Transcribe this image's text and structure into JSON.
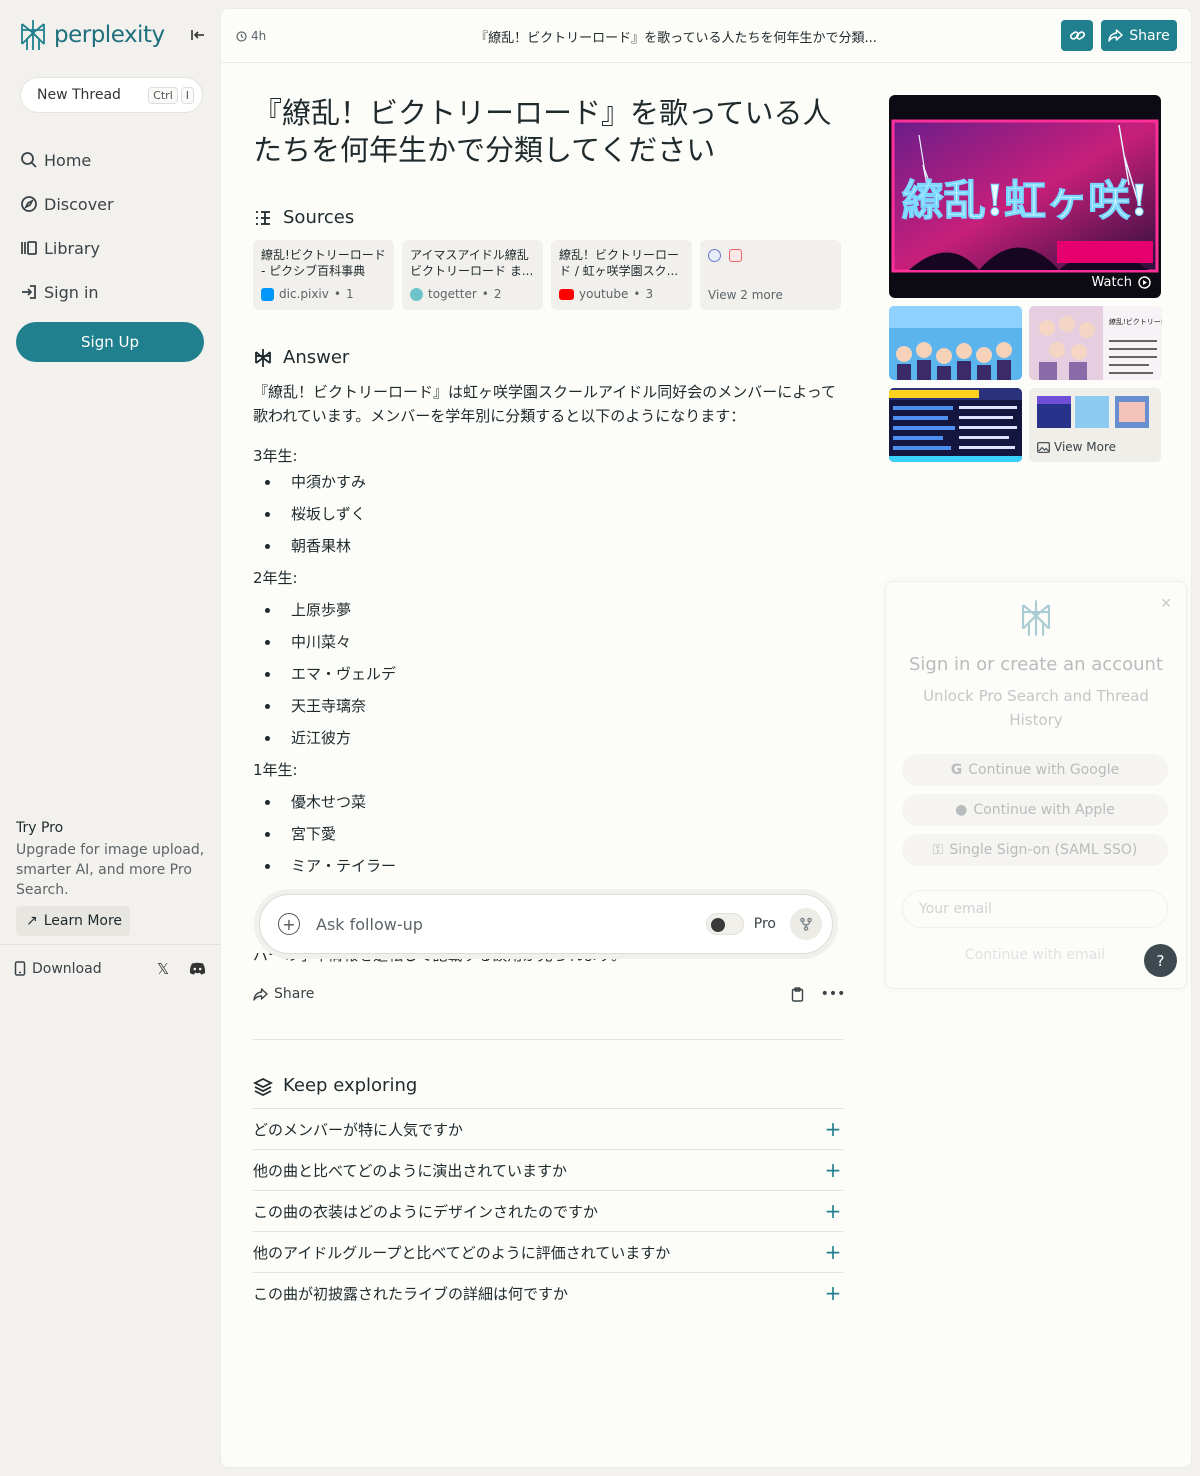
{
  "brand": {
    "name": "perplexity",
    "color": "#20808d"
  },
  "sidebar": {
    "new_thread": "New Thread",
    "shortcut": [
      "Ctrl",
      "I"
    ],
    "nav": [
      {
        "label": "Home",
        "icon": "search-icon"
      },
      {
        "label": "Discover",
        "icon": "compass-icon"
      },
      {
        "label": "Library",
        "icon": "library-icon"
      },
      {
        "label": "Sign in",
        "icon": "sign-in-icon"
      }
    ],
    "signup": "Sign Up",
    "try_pro": {
      "title": "Try Pro",
      "text": "Upgrade for image upload, smarter AI, and more Pro Search.",
      "learn_more": "Learn More"
    },
    "download": "Download"
  },
  "topbar": {
    "time": "4h",
    "title": "『繚乱！ビクトリーロード』を歌っている人たちを何年生かで分類...",
    "share": "Share"
  },
  "thread": {
    "question": "『繚乱！ビクトリーロード』を歌っている人たちを何年生かで分類してください",
    "sources_label": "Sources",
    "sources": [
      {
        "title": "繚乱!ビクトリーロード - ピクシブ百科事典",
        "site": "dic.pixiv",
        "num": "1",
        "color": "#0096fa"
      },
      {
        "title": "アイマスアイドル繚乱ビクトリーロード ま...",
        "site": "togetter",
        "num": "2",
        "color": "#6cc3c9"
      },
      {
        "title": "繚乱！ビクトリーロード / 虹ヶ咲学園スク...",
        "site": "youtube",
        "num": "3",
        "color": "#ff0000"
      }
    ],
    "view_more_sources": "View 2 more",
    "answer_label": "Answer",
    "answer_intro": "『繚乱！ビクトリーロード』は虹ヶ咲学園スクールアイドル同好会のメンバーによって歌われています。メンバーを学年別に分類すると以下のようになります：",
    "groups": [
      {
        "grade": "3年生:",
        "members": [
          "中須かすみ",
          "桜坂しずく",
          "朝香果林"
        ]
      },
      {
        "grade": "2年生:",
        "members": [
          "上原歩夢",
          "中川菜々",
          "エマ・ヴェルデ",
          "天王寺璃奈",
          "近江彼方"
        ]
      },
      {
        "grade": "1年生:",
        "members": [
          "優木せつ菜",
          "宮下愛",
          "ミア・テイラー"
        ]
      }
    ],
    "cutoff_text": "バーの学年情報を逆転して記載する誤用が見られます。",
    "share": "Share",
    "keep_exploring": "Keep exploring",
    "related": [
      "どのメンバーが特に人気ですか",
      "他の曲と比べてどのように演出されていますか",
      "この曲の衣装はどのようにデザインされたのですか",
      "他のアイドルグループと比べてどのように評価されていますか",
      "この曲が初披露されたライブの詳細は何ですか"
    ]
  },
  "ask": {
    "placeholder": "Ask follow-up",
    "pro": "Pro"
  },
  "media": {
    "watch": "Watch",
    "video_caption": "繚乱!虹ヶ咲!",
    "thumb_caption": "繚乱!ビクトリーロード",
    "view_more": "View More"
  },
  "signin": {
    "title": "Sign in or create an account",
    "subtitle": "Unlock Pro Search and Thread History",
    "google": "Continue with Google",
    "apple": "Continue with Apple",
    "sso": "Single Sign-on (SAML SSO)",
    "email_placeholder": "Your email",
    "continue_email": "Continue with email"
  },
  "help": "?"
}
